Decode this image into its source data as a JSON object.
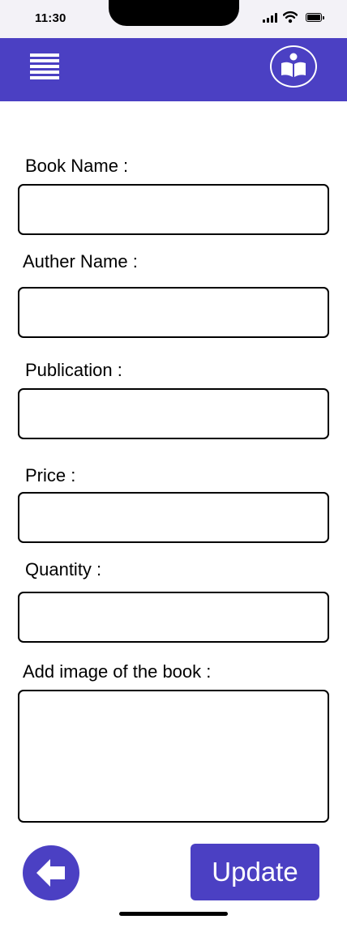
{
  "status_bar": {
    "time": "11:30"
  },
  "header": {
    "menu_icon": "hamburger-menu-icon",
    "reader_icon": "book-reader-icon",
    "accent_color": "#4b40c3"
  },
  "form": {
    "book_name": {
      "label": "Book Name :",
      "value": ""
    },
    "author_name": {
      "label": "Auther Name :",
      "value": ""
    },
    "publication": {
      "label": "Publication :",
      "value": ""
    },
    "price": {
      "label": "Price :",
      "value": ""
    },
    "quantity": {
      "label": "Quantity :",
      "value": ""
    },
    "image": {
      "label": "Add image of the book :"
    }
  },
  "footer": {
    "back_icon": "arrow-left-icon",
    "update_label": "Update"
  }
}
